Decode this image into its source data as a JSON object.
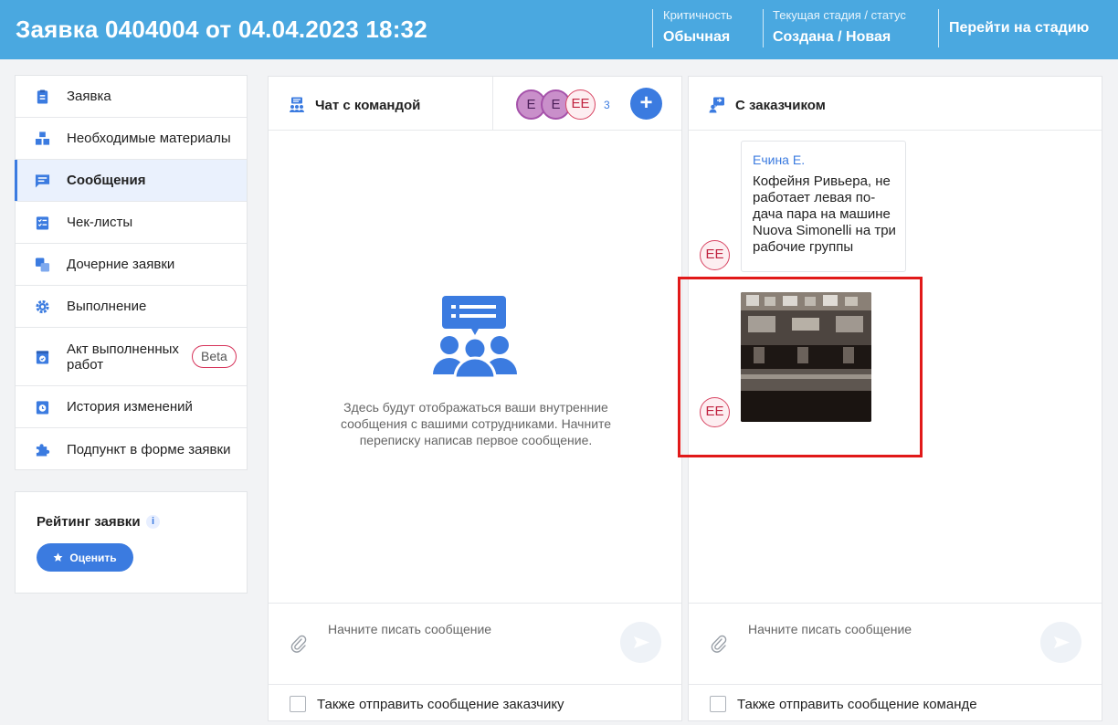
{
  "header": {
    "title": "Заявка 0404004 от 04.04.2023 18:32",
    "criticality_label": "Критичность",
    "criticality_value": "Обычная",
    "stage_label": "Текущая стадия / статус",
    "stage_value": "Создана / Новая",
    "goto_stage": "Перейти на стадию"
  },
  "sidebar": {
    "items": [
      {
        "label": "Заявка",
        "icon": "clipboard-icon"
      },
      {
        "label": "Необходимые материалы",
        "icon": "boxes-icon"
      },
      {
        "label": "Сообщения",
        "icon": "message-icon",
        "active": true
      },
      {
        "label": "Чек-листы",
        "icon": "checklist-icon"
      },
      {
        "label": "Дочерние заявки",
        "icon": "child-requests-icon"
      },
      {
        "label": "Выполнение",
        "icon": "gear-icon"
      },
      {
        "label": "Акт выполненных работ",
        "icon": "act-icon",
        "badge": "Beta"
      },
      {
        "label": "История изменений",
        "icon": "history-icon"
      },
      {
        "label": "Подпункт в форме заявки",
        "icon": "puzzle-icon"
      }
    ]
  },
  "rating": {
    "title": "Рейтинг заявки",
    "info": "i",
    "button": "Оценить"
  },
  "team_chat": {
    "title": "Чат с командой",
    "avatars": [
      "Е",
      "Е",
      "ЕЕ"
    ],
    "count": "3",
    "add": "+",
    "empty_text": "Здесь будут отображаться ваши внутренние сообщения с вашими сотрудниками. Начните переписку написав первое сообщение.",
    "placeholder": "Начните писать сообщение",
    "checkbox_label": "Также отправить сообщение заказчику"
  },
  "customer_chat": {
    "title": "С заказчиком",
    "messages": [
      {
        "author": "Ечина Е.",
        "avatar": "ЕЕ",
        "text": "Кофейня Ривьера, не работает левая по-дача пара на машине Nuova Simonelli на три рабочие группы"
      },
      {
        "avatar": "ЕЕ",
        "image": "coffee-machine-photo"
      }
    ],
    "placeholder": "Начните писать сообщение",
    "checkbox_label": "Также отправить сообщение команде"
  },
  "colors": {
    "header_bg": "#4aa8e0",
    "accent": "#3b7be0",
    "highlight": "#e11919",
    "avatar_ee": "#d84563"
  }
}
